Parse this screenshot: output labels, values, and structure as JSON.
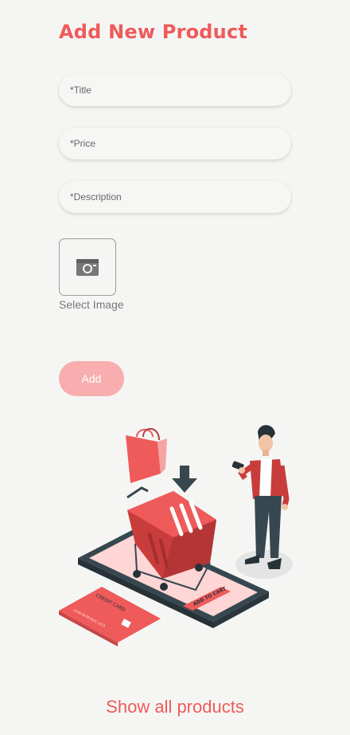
{
  "page": {
    "title": "Add New Product",
    "show_all_label": "Show all products"
  },
  "form": {
    "title_placeholder": "*Title",
    "price_placeholder": "*Price",
    "description_placeholder": "*Description",
    "select_image_label": "Select Image",
    "add_label": "Add"
  },
  "illustration": {
    "card_text": "CREDIT CARD",
    "card_number": "1234 5678 9101 1213",
    "phone_button_text": "ADD TO CART"
  },
  "colors": {
    "accent": "#ef5a5a",
    "button_bg": "#f8aeae",
    "background": "#f5f6f4"
  },
  "icons": {
    "image_picker": "camera-icon"
  }
}
